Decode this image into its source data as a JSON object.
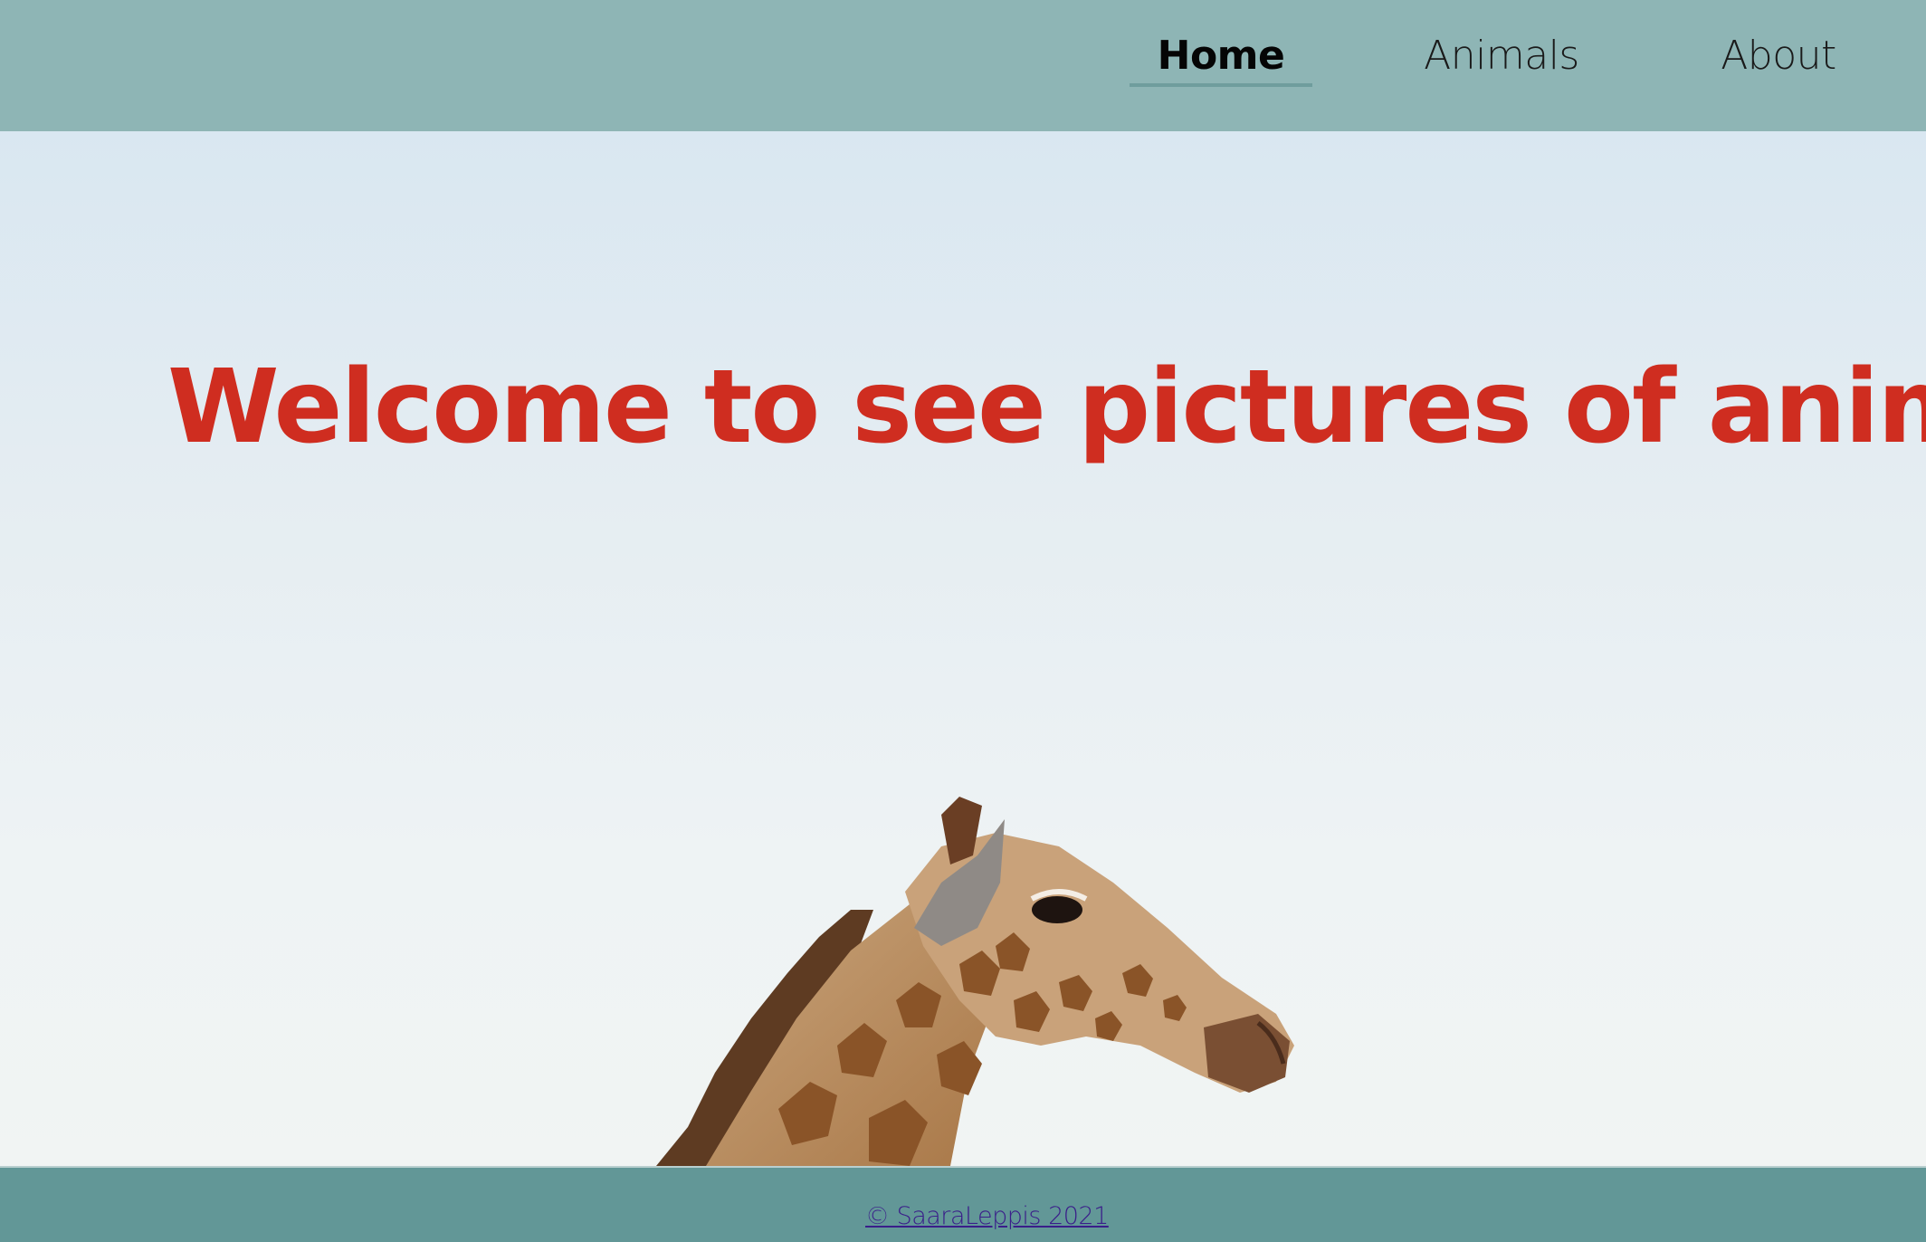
{
  "nav": {
    "items": [
      {
        "label": "Home",
        "active": true
      },
      {
        "label": "Animals",
        "active": false
      },
      {
        "label": "About",
        "active": false
      }
    ]
  },
  "hero": {
    "title": "Welcome to see pictures of animals",
    "image": "giraffe-photo"
  },
  "footer": {
    "copyright": "© SaaraLeppis 2021"
  },
  "colors": {
    "header_bg": "#8eb5b5",
    "footer_bg": "#629797",
    "title": "#cf2d20",
    "active_underline": "#6f9d9d",
    "footer_link": "#3a1e8a"
  }
}
